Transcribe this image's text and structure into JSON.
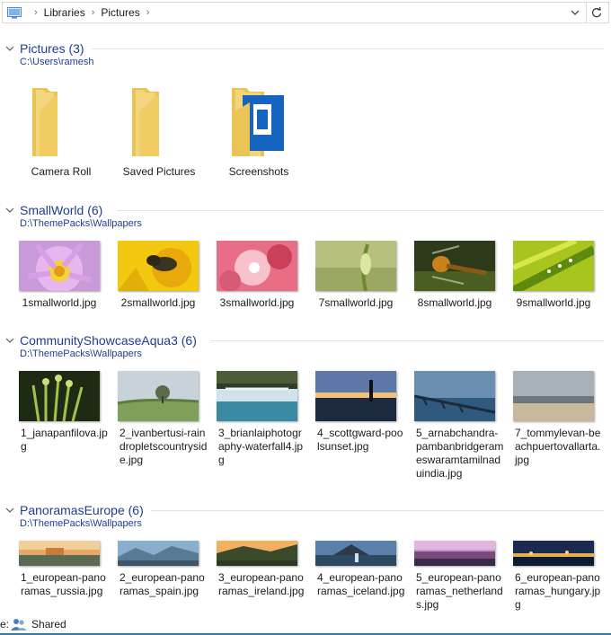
{
  "address": {
    "crumbs": [
      "Libraries",
      "Pictures"
    ]
  },
  "groups": [
    {
      "title": "Pictures (3)",
      "path": "C:\\Users\\ramesh",
      "items": [
        {
          "label": "Camera Roll"
        },
        {
          "label": "Saved Pictures"
        },
        {
          "label": "Screenshots"
        }
      ]
    },
    {
      "title": "SmallWorld (6)",
      "path": "D:\\ThemePacks\\Wallpapers",
      "items": [
        {
          "label": "1smallworld.jpg"
        },
        {
          "label": "2smallworld.jpg"
        },
        {
          "label": "3smallworld.jpg"
        },
        {
          "label": "7smallworld.jpg"
        },
        {
          "label": "8smallworld.jpg"
        },
        {
          "label": "9smallworld.jpg"
        }
      ]
    },
    {
      "title": "CommunityShowcaseAqua3 (6)",
      "path": "D:\\ThemePacks\\Wallpapers",
      "items": [
        {
          "label": "1_janapanfilova.jpg"
        },
        {
          "label": "2_ivanbertusi-raindropletscountryside.jpg"
        },
        {
          "label": "3_brianlaiphotography-waterfall4.jpg"
        },
        {
          "label": "4_scottgward-poolsunset.jpg"
        },
        {
          "label": "5_arnabchandra-pambanbridgerameswaramtamilnaduindia.jpg"
        },
        {
          "label": "7_tommylevan-beachpuertovallarta.jpg"
        }
      ]
    },
    {
      "title": "PanoramasEurope (6)",
      "path": "D:\\ThemePacks\\Wallpapers",
      "items": [
        {
          "label": "1_european-panoramas_russia.jpg"
        },
        {
          "label": "2_european-panoramas_spain.jpg"
        },
        {
          "label": "3_european-panoramas_ireland.jpg"
        },
        {
          "label": "4_european-panoramas_iceland.jpg"
        },
        {
          "label": "5_european-panoramas_netherlands.jpg"
        },
        {
          "label": "6_european-panoramas_hungary.jpg"
        }
      ]
    }
  ],
  "status": {
    "prefix": "e:",
    "text": "Shared"
  }
}
